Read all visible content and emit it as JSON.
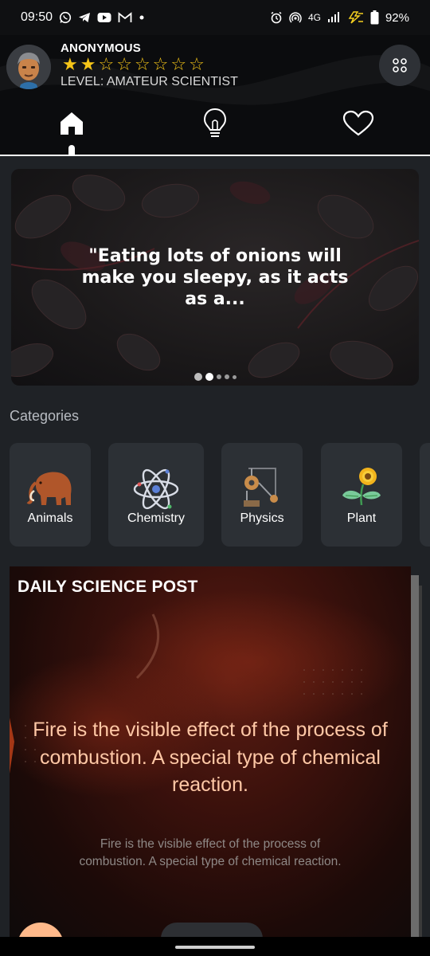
{
  "status_bar": {
    "time": "09:50",
    "network": "4G",
    "battery": "92%",
    "left_icons": [
      "whatsapp-icon",
      "telegram-icon",
      "youtube-icon",
      "gmail-icon",
      "dot-icon"
    ],
    "right_icons": [
      "alarm-icon",
      "hotspot-icon",
      "signal-icon",
      "charging-icon",
      "battery-icon"
    ]
  },
  "profile": {
    "name": "ANONYMOUS",
    "stars_filled": 2,
    "stars_total": 8,
    "level": "LEVEL: AMATEUR SCIENTIST"
  },
  "nav": {
    "items": [
      {
        "icon": "home-icon",
        "active": true
      },
      {
        "icon": "lightbulb-icon",
        "active": false
      },
      {
        "icon": "heart-icon",
        "active": false
      }
    ]
  },
  "carousel": {
    "text": "\"Eating lots of onions will make you sleepy, as it acts as a...",
    "slides": 5,
    "active_slide": 1
  },
  "categories": {
    "label": "Categories",
    "items": [
      {
        "label": "Animals",
        "icon": "mammoth-icon"
      },
      {
        "label": "Chemistry",
        "icon": "atom-icon"
      },
      {
        "label": "Physics",
        "icon": "pulley-icon"
      },
      {
        "label": "Plant",
        "icon": "flower-icon"
      }
    ]
  },
  "daily_post": {
    "title": "DAILY SCIENCE POST",
    "headline": "Fire is the visible effect of the process of combustion. A special type of chemical reaction.",
    "caption": "Fire is the visible effect of the process of combustion.  A special type of chemical reaction."
  },
  "colors": {
    "background": "#1f2226",
    "card": "#2c3035",
    "star": "#f5c518",
    "headline": "#ffc8a6"
  }
}
